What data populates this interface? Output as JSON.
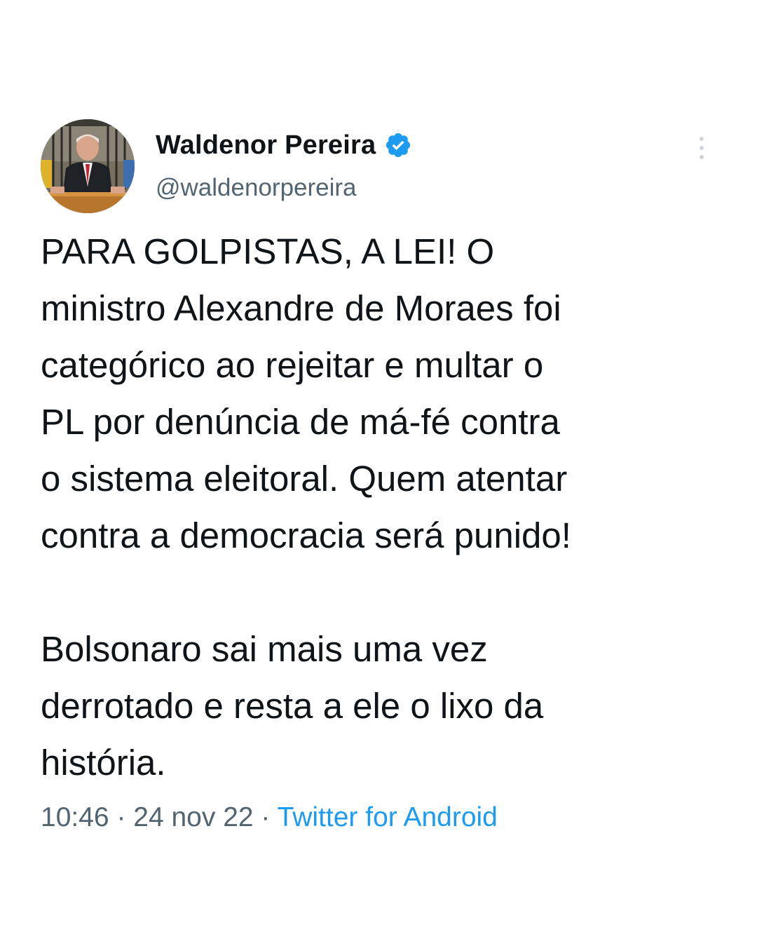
{
  "author": {
    "display_name": "Waldenor Pereira",
    "handle": "@waldenorpereira",
    "verified": true,
    "avatar_icon": "profile-photo",
    "verified_icon": "verified-badge-icon",
    "verified_color": "#1d9bf0"
  },
  "more_icon": "more-vertical-icon",
  "tweet": {
    "text": "PARA GOLPISTAS, A LEI! O\nministro Alexandre de Moraes foi\ncategórico ao rejeitar e multar o\nPL por denúncia de má-fé contra\no sistema eleitoral. Quem atentar\ncontra a democracia será punido!\n\nBolsonaro sai mais uma vez\nderrotado e resta a ele o lixo da\nhistória.",
    "time": "10:46",
    "separator": " · ",
    "date": "24 nov 22",
    "source": "Twitter for Android"
  },
  "colors": {
    "text": "#0f1419",
    "secondary": "#536471",
    "link": "#1d9bf0"
  }
}
